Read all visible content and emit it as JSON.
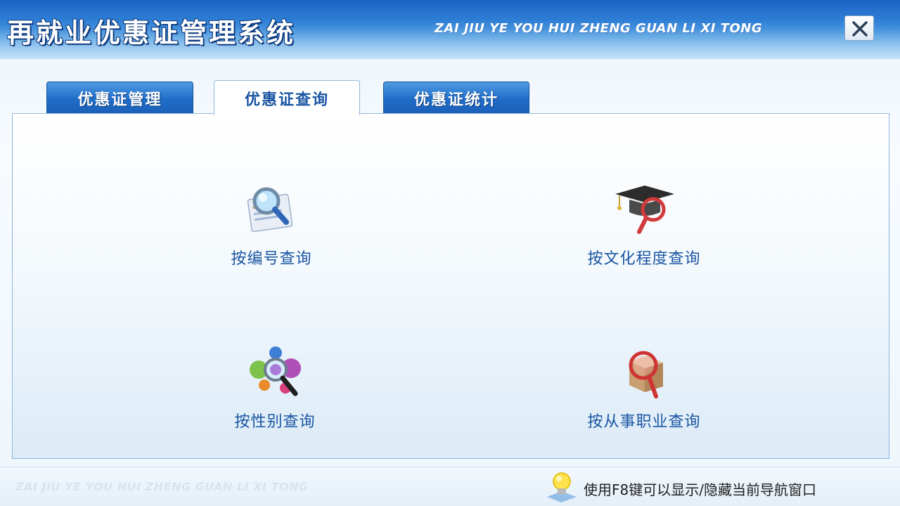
{
  "window": {
    "title": "再就业优惠证管理系统",
    "title_pinyin": "ZAI JIU YE YOU HUI ZHENG GUAN LI XI TONG"
  },
  "tabs": [
    {
      "label": "优惠证管理",
      "active": false
    },
    {
      "label": "优惠证查询",
      "active": true
    },
    {
      "label": "优惠证统计",
      "active": false
    }
  ],
  "queries": [
    {
      "label": "按编号查询",
      "icon": "search-document-icon"
    },
    {
      "label": "按文化程度查询",
      "icon": "graduation-cap-search-icon"
    },
    {
      "label": "按性别查询",
      "icon": "people-search-icon"
    },
    {
      "label": "按从事职业查询",
      "icon": "box-search-icon"
    }
  ],
  "statusbar": {
    "watermark": "ZAI JIU YE YOU HUI ZHENG GUAN LI XI TONG",
    "hint": "使用F8键可以显示/隐藏当前导航窗口",
    "icon": "lightbulb-icon"
  },
  "colors": {
    "accent": "#1a56a3",
    "title_bar": "#2f7fd6",
    "tab_inactive": "#1f6cc8"
  }
}
